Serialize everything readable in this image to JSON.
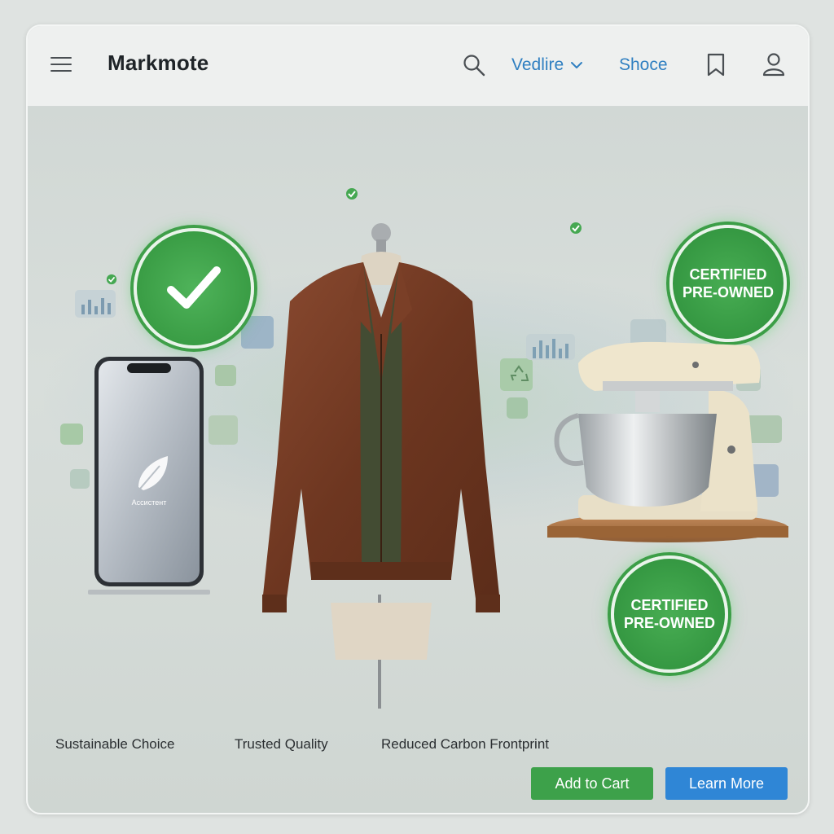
{
  "header": {
    "brand": "Markmote",
    "menu_icon": "hamburger-menu-icon",
    "search_icon": "search-icon",
    "dropdown_label": "Vedlire",
    "dropdown_icon": "chevron-down-icon",
    "link_label": "Shoce",
    "bookmark_icon": "bookmark-icon",
    "profile_icon": "user-profile-icon"
  },
  "badges": {
    "verified_icon": "checkmark-icon",
    "certified_line1": "CERTIFIED",
    "certified_line2": "PRE-OWNED"
  },
  "products": {
    "phone_caption": "Ассистент",
    "phone_icon": "leaf-icon"
  },
  "features": [
    "Sustainable Choice",
    "Trusted Quality",
    "Reduced Carbon Frontprint"
  ],
  "actions": {
    "add_to_cart": "Add to Cart",
    "learn_more": "Learn More"
  },
  "colors": {
    "accent_green": "#3da14a",
    "accent_blue": "#2f86d6",
    "link_blue": "#2f7fc1"
  }
}
